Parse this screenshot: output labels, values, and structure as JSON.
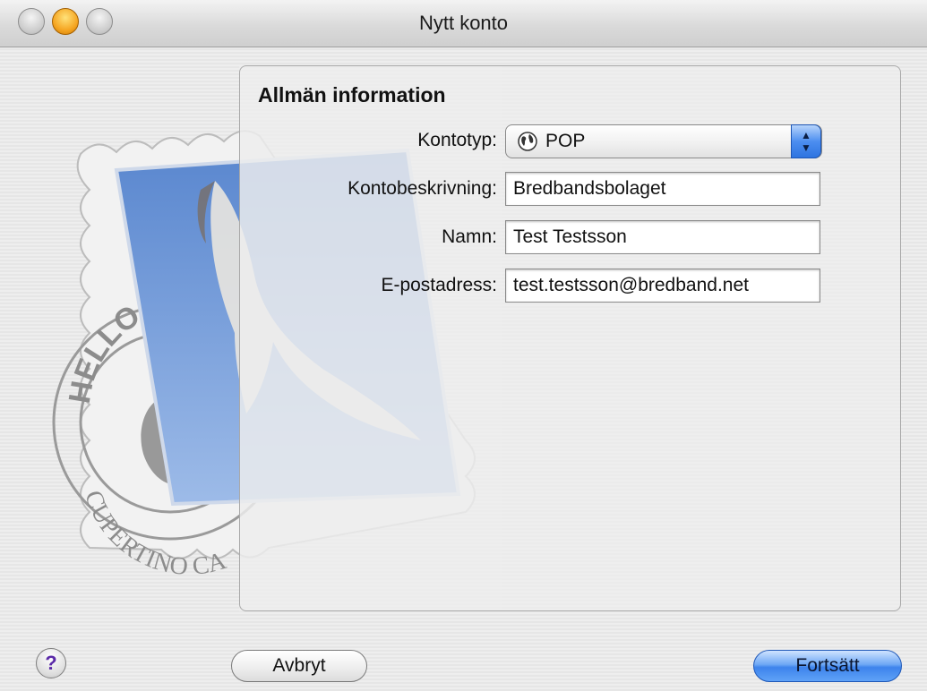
{
  "window": {
    "title": "Nytt konto"
  },
  "section": {
    "title": "Allmän information"
  },
  "form": {
    "account_type": {
      "label": "Kontotyp:",
      "value": "POP",
      "icon": "globe-icon"
    },
    "description": {
      "label": "Kontobeskrivning:",
      "value": "Bredbandsbolaget"
    },
    "name": {
      "label": "Namn:",
      "value": "Test Testsson"
    },
    "email": {
      "label": "E-postadress:",
      "value": "test.testsson@bredband.net"
    }
  },
  "buttons": {
    "help": "?",
    "cancel": "Avbryt",
    "continue": "Fortsätt"
  },
  "artwork": {
    "stamp_text_top": "HELLO FR",
    "stamp_text_bottom": "CUPERTINO CA"
  },
  "colors": {
    "accent_blue": "#3d83ec",
    "minimize_yellow": "#f5a623"
  }
}
